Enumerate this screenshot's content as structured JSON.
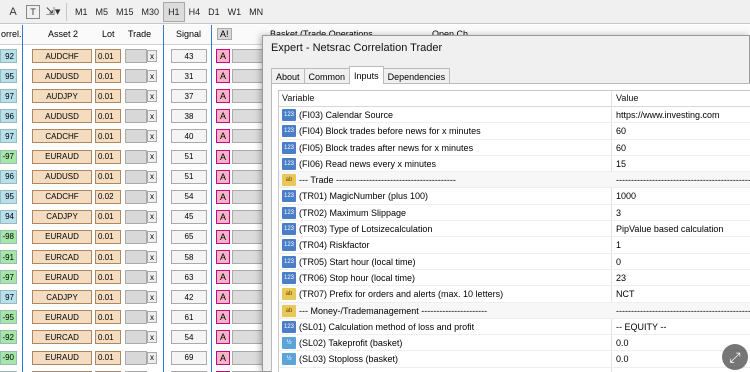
{
  "toolbar": {
    "timeframes": [
      "M1",
      "M5",
      "M15",
      "M30",
      "H1",
      "H4",
      "D1",
      "W1",
      "MN"
    ],
    "active_timeframe": "H1"
  },
  "dashboard": {
    "headers": {
      "correl": "orrel.",
      "asset2": "Asset 2",
      "lot": "Lot",
      "trade": "Trade",
      "signal": "Signal",
      "a_flag": "A!",
      "basket": "Basket (Trade Operations",
      "open": "Open Ch"
    },
    "rows": [
      {
        "correl": "92",
        "sign": "pos",
        "asset": "AUDCHF",
        "lot": "0.01",
        "trade": "x",
        "signal": "43",
        "flag": "A"
      },
      {
        "correl": "95",
        "sign": "pos",
        "asset": "AUDUSD",
        "lot": "0.01",
        "trade": "x",
        "signal": "31",
        "flag": "A"
      },
      {
        "correl": "97",
        "sign": "pos",
        "asset": "AUDJPY",
        "lot": "0.01",
        "trade": "x",
        "signal": "37",
        "flag": "A"
      },
      {
        "correl": "96",
        "sign": "pos",
        "asset": "AUDUSD",
        "lot": "0.01",
        "trade": "x",
        "signal": "38",
        "flag": "A"
      },
      {
        "correl": "97",
        "sign": "pos",
        "asset": "CADCHF",
        "lot": "0.01",
        "trade": "x",
        "signal": "40",
        "flag": "A"
      },
      {
        "correl": "-97",
        "sign": "neg",
        "asset": "EURAUD",
        "lot": "0.01",
        "trade": "x",
        "signal": "51",
        "flag": "A"
      },
      {
        "correl": "96",
        "sign": "pos",
        "asset": "AUDUSD",
        "lot": "0.01",
        "trade": "x",
        "signal": "51",
        "flag": "A"
      },
      {
        "correl": "95",
        "sign": "pos",
        "asset": "CADCHF",
        "lot": "0.02",
        "trade": "x",
        "signal": "54",
        "flag": "A"
      },
      {
        "correl": "94",
        "sign": "pos",
        "asset": "CADJPY",
        "lot": "0.01",
        "trade": "x",
        "signal": "45",
        "flag": "A"
      },
      {
        "correl": "-98",
        "sign": "neg",
        "asset": "EURAUD",
        "lot": "0.01",
        "trade": "x",
        "signal": "65",
        "flag": "A"
      },
      {
        "correl": "-91",
        "sign": "neg",
        "asset": "EURCAD",
        "lot": "0.01",
        "trade": "x",
        "signal": "58",
        "flag": "A"
      },
      {
        "correl": "-97",
        "sign": "neg",
        "asset": "EURAUD",
        "lot": "0.01",
        "trade": "x",
        "signal": "63",
        "flag": "A"
      },
      {
        "correl": "97",
        "sign": "pos",
        "asset": "CADJPY",
        "lot": "0.01",
        "trade": "x",
        "signal": "42",
        "flag": "A"
      },
      {
        "correl": "-95",
        "sign": "neg",
        "asset": "EURAUD",
        "lot": "0.01",
        "trade": "x",
        "signal": "61",
        "flag": "A"
      },
      {
        "correl": "-92",
        "sign": "neg",
        "asset": "EURCAD",
        "lot": "0.01",
        "trade": "x",
        "signal": "54",
        "flag": "A"
      },
      {
        "correl": "-90",
        "sign": "neg",
        "asset": "EURAUD",
        "lot": "0.01",
        "trade": "x",
        "signal": "69",
        "flag": "A"
      },
      {
        "correl": "-97",
        "sign": "neg",
        "asset": "EURCAD",
        "lot": "0.01",
        "trade": "x",
        "signal": "62",
        "flag": "A"
      }
    ]
  },
  "dialog": {
    "title": "Expert - Netsrac Correlation Trader",
    "tabs": [
      "About",
      "Common",
      "Inputs",
      "Dependencies"
    ],
    "active_tab": "Inputs",
    "columns": {
      "variable": "Variable",
      "value": "Value"
    },
    "rows": [
      {
        "icon": "num",
        "icon_text": "123",
        "variable": "(FI03) Calendar Source",
        "value": "https://www.investing.com"
      },
      {
        "icon": "num",
        "icon_text": "123",
        "variable": "(FI04) Block trades before news for x minutes",
        "value": "60"
      },
      {
        "icon": "num",
        "icon_text": "123",
        "variable": "(FI05) Block trades after news for x minutes",
        "value": "60"
      },
      {
        "icon": "num",
        "icon_text": "123",
        "variable": "(FI06) Read news every x minutes",
        "value": "15"
      },
      {
        "icon": "str",
        "icon_text": "ab",
        "variable": "--- Trade ----------------------------------------",
        "value": "--------------------------------------------------",
        "section": true
      },
      {
        "icon": "num",
        "icon_text": "123",
        "variable": "(TR01) MagicNumber (plus 100)",
        "value": "1000"
      },
      {
        "icon": "num",
        "icon_text": "123",
        "variable": "(TR02) Maximum Slippage",
        "value": "3"
      },
      {
        "icon": "num",
        "icon_text": "123",
        "variable": "(TR03) Type of Lotsizecalculation",
        "value": "PipValue based calculation"
      },
      {
        "icon": "num",
        "icon_text": "123",
        "variable": "(TR04) Riskfactor",
        "value": "1"
      },
      {
        "icon": "num",
        "icon_text": "123",
        "variable": "(TR05) Start hour (local time)",
        "value": "0"
      },
      {
        "icon": "num",
        "icon_text": "123",
        "variable": "(TR06) Stop hour (local time)",
        "value": "23"
      },
      {
        "icon": "str",
        "icon_text": "ab",
        "variable": "(TR07) Prefix for orders and alerts (max. 10 letters)",
        "value": "NCT"
      },
      {
        "icon": "str",
        "icon_text": "ab",
        "variable": "--- Money-/Trademanagement ----------------------",
        "value": "--------------------------------------------------",
        "section": true
      },
      {
        "icon": "num",
        "icon_text": "123",
        "variable": "(SL01) Calculation method of loss and profit",
        "value": "-- EQUITY --"
      },
      {
        "icon": "dbl",
        "icon_text": "½",
        "variable": "(SL02) Takeprofit (basket)",
        "value": "0.0"
      },
      {
        "icon": "dbl",
        "icon_text": "½",
        "variable": "(SL03) Stoploss (basket)",
        "value": "0.0"
      }
    ]
  }
}
